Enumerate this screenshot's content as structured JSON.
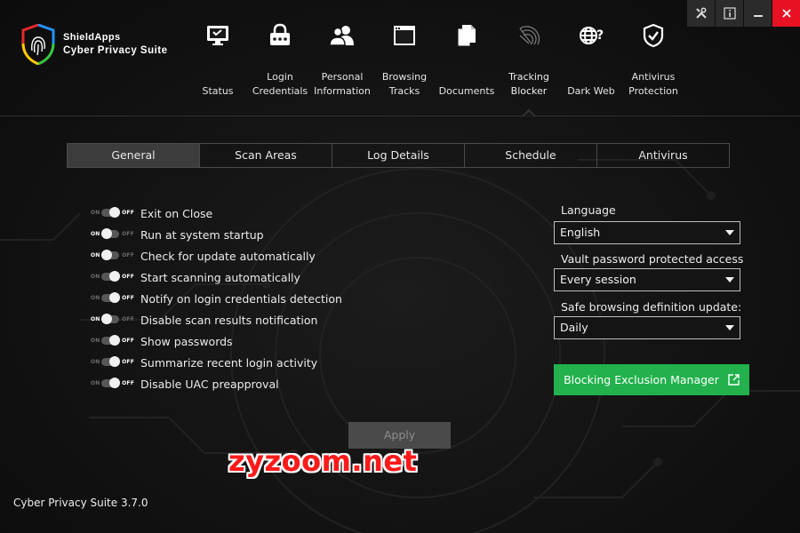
{
  "brand": {
    "line1": "ShieldApps",
    "line2": "Cyber Privacy Suite"
  },
  "nav": [
    {
      "name": "status",
      "line1": "",
      "line2": "Status",
      "icon": "monitor-icon"
    },
    {
      "name": "login-credentials",
      "line1": "Login",
      "line2": "Credentials",
      "icon": "password-lock-icon"
    },
    {
      "name": "personal-information",
      "line1": "Personal",
      "line2": "Information",
      "icon": "users-icon"
    },
    {
      "name": "browsing-tracks",
      "line1": "Browsing",
      "line2": "Tracks",
      "icon": "browser-window-icon"
    },
    {
      "name": "documents",
      "line1": "",
      "line2": "Documents",
      "icon": "documents-icon"
    },
    {
      "name": "tracking-blocker",
      "line1": "Tracking",
      "line2": "Blocker",
      "icon": "radar-icon",
      "active": true
    },
    {
      "name": "dark-web",
      "line1": "",
      "line2": "Dark Web",
      "icon": "globe-question-icon"
    },
    {
      "name": "antivirus-protection",
      "line1": "Antivirus",
      "line2": "Protection",
      "icon": "shield-check-icon"
    }
  ],
  "window_controls": [
    "tools-icon",
    "info-icon",
    "minimize-icon",
    "close-icon"
  ],
  "tabs": [
    {
      "label": "General",
      "active": true
    },
    {
      "label": "Scan Areas"
    },
    {
      "label": "Log Details"
    },
    {
      "label": "Schedule"
    },
    {
      "label": "Antivirus"
    }
  ],
  "toggle_text": {
    "on": "ON",
    "off": "OFF"
  },
  "settings": [
    {
      "label": "Exit on Close",
      "state": "off"
    },
    {
      "label": "Run at system startup",
      "state": "on"
    },
    {
      "label": "Check for update automatically",
      "state": "on"
    },
    {
      "label": "Start scanning automatically",
      "state": "off"
    },
    {
      "label": "Notify on login credentials detection",
      "state": "off"
    },
    {
      "label": "Disable scan results notification",
      "state": "on"
    },
    {
      "label": "Show passwords",
      "state": "off"
    },
    {
      "label": "Summarize recent login activity",
      "state": "off"
    },
    {
      "label": "Disable UAC preapproval",
      "state": "off"
    }
  ],
  "language": {
    "label": "Language",
    "value": "English"
  },
  "vault": {
    "label": "Vault password protected access",
    "value": "Every session"
  },
  "safe_browsing": {
    "label": "Safe browsing definition update:",
    "value": "Daily"
  },
  "exclusion_button": {
    "label": "Blocking Exclusion Manager"
  },
  "apply_button": {
    "label": "Apply"
  },
  "watermark": "zyzoom.net",
  "version": "Cyber Privacy Suite 3.7.0",
  "colors": {
    "accent_green": "#22b14c",
    "close_red": "#e81123",
    "watermark_red": "#ff1a1a"
  }
}
